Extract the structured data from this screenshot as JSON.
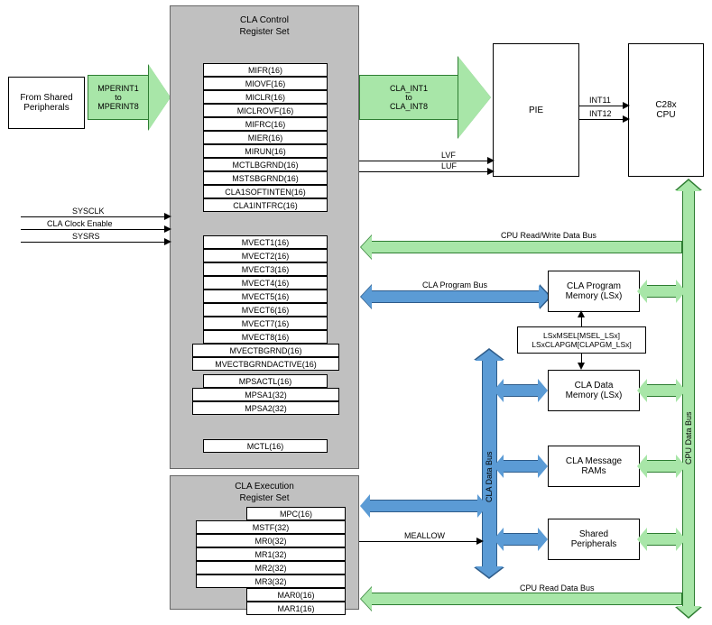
{
  "blocks": {
    "from_shared": {
      "line1": "From Shared",
      "line2": "Peripherals"
    },
    "pie": "PIE",
    "cpu": "C28x\nCPU",
    "cla_ctrl_title1": "CLA Control",
    "cla_ctrl_title2": "Register Set",
    "cla_exec_title1": "CLA Execution",
    "cla_exec_title2": "Register Set",
    "cla_prog_mem": "CLA Program\nMemory (LSx)",
    "lsx_msel": "LSxMSEL[MSEL_LSx]\nLSxCLAPGM[CLAPGM_LSx]",
    "cla_data_mem": "CLA Data\nMemory (LSx)",
    "cla_msg_ram": "CLA Message\nRAMs",
    "shared_periph": "Shared\nPeripherals"
  },
  "green_arrows": {
    "mperint": "MPERINT1\nto\nMPERINT8",
    "cla_int": "CLA_INT1\nto\nCLA_INT8"
  },
  "signals": {
    "int11": "INT11",
    "int12": "INT12",
    "lvf": "LVF",
    "luf": "LUF",
    "sysclk": "SYSCLK",
    "cla_clk_en": "CLA Clock Enable",
    "sysrs": "SYSRS",
    "meallow": "MEALLOW"
  },
  "buses": {
    "cpu_rw": "CPU Read/Write Data Bus",
    "cla_prog": "CLA Program Bus",
    "cla_data": "CLA Data Bus",
    "cpu_data": "CPU Data Bus",
    "cpu_read": "CPU Read Data Bus"
  },
  "ctrl_regs1": [
    "MIFR(16)",
    "MIOVF(16)",
    "MICLR(16)",
    "MICLROVF(16)",
    "MIFRC(16)",
    "MIER(16)",
    "MIRUN(16)",
    "MCTLBGRND(16)",
    "MSTSBGRND(16)",
    "CLA1SOFTINTEN(16)",
    "CLA1INTFRC(16)"
  ],
  "ctrl_regs2": [
    "MVECT1(16)",
    "MVECT2(16)",
    "MVECT3(16)",
    "MVECT4(16)",
    "MVECT5(16)",
    "MVECT6(16)",
    "MVECT7(16)",
    "MVECT8(16)",
    "MVECTBGRND(16)",
    "MVECTBGRNDACTIVE(16)",
    "MPSACTL(16)",
    "MPSA1(32)",
    "MPSA2(32)"
  ],
  "mctl": "MCTL(16)",
  "exec_regs_top": "MPC(16)",
  "exec_regs": [
    "MSTF(32)",
    "MR0(32)",
    "MR1(32)",
    "MR2(32)",
    "MR3(32)"
  ],
  "exec_regs_bottom": [
    "MAR0(16)",
    "MAR1(16)"
  ]
}
